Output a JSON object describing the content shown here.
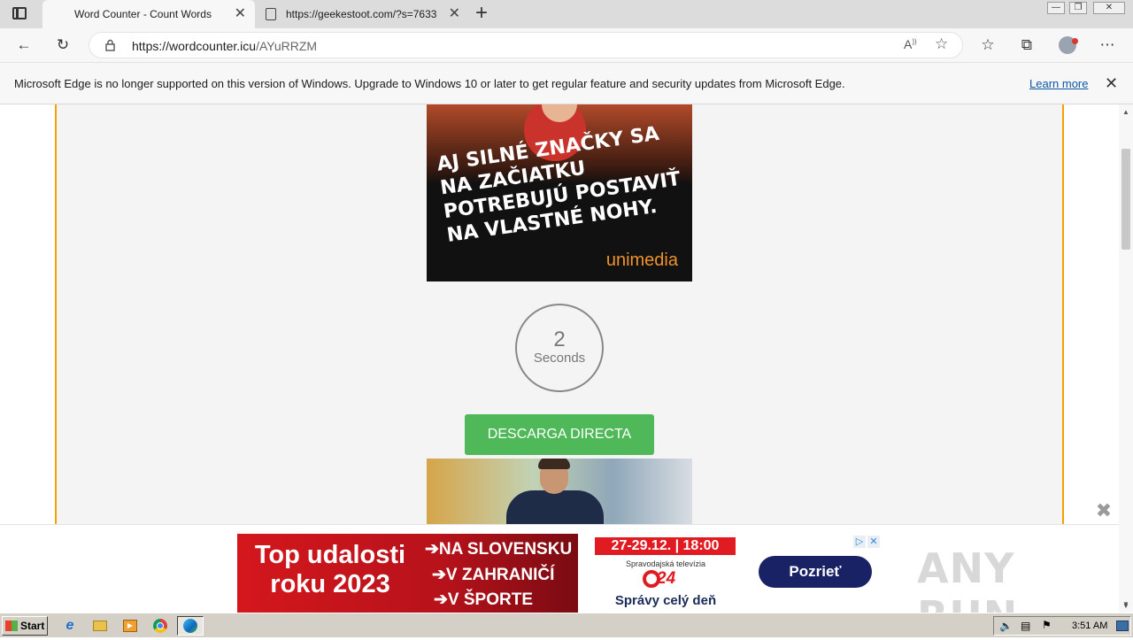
{
  "browser": {
    "tabs": [
      {
        "title": "Word Counter - Count Words",
        "active": true
      },
      {
        "title": "https://geekestoot.com/?s=7633",
        "active": false
      }
    ],
    "new_tab_label": "+",
    "url_host": "https://wordcounter.icu",
    "url_path": "/AYuRRZM"
  },
  "infobar": {
    "message": "Microsoft Edge is no longer supported on this version of Windows. Upgrade to Windows 10 or later to get regular feature and security updates from Microsoft Edge.",
    "link": "Learn more"
  },
  "page": {
    "ad_top": {
      "slogan": "AJ SILNÉ ZNAČKY SA NA ZAČIATKU POTREBUJÚ POSTAVIŤ NA VLASTNÉ NOHY.",
      "brand": "unimedia"
    },
    "timer": {
      "value": "2",
      "unit": "Seconds"
    },
    "download_button": "DESCARGA DIRECTA"
  },
  "bottom_ad": {
    "title": "Top udalosti roku 2023",
    "items": [
      "➔NA SLOVENSKU",
      "➔V ZAHRANIČÍ",
      "➔V ŠPORTE"
    ],
    "date": "27-29.12. | 18:00",
    "channel": "Spravodajská televízia",
    "logo_number": "24",
    "tagline": "Správy celý deň",
    "cta": "Pozrieť",
    "close_glyph": "✖",
    "watermark": "ANY RUN"
  },
  "taskbar": {
    "start": "Start",
    "clock": "3:51 AM"
  },
  "colors": {
    "accent_border": "#f2a100",
    "download_green": "#4fb858",
    "ad_red": "#d4171d",
    "cta_navy": "#1a2266"
  }
}
